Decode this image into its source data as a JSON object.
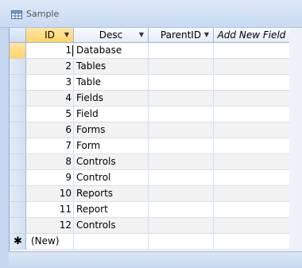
{
  "window": {
    "title": "Sample"
  },
  "columns": [
    {
      "label": "ID",
      "sort_indicator": "▼"
    },
    {
      "label": "Desc",
      "sort_indicator": "▼"
    },
    {
      "label": "ParentID",
      "sort_indicator": "▼"
    },
    {
      "label": "Add New Field"
    }
  ],
  "rows": [
    {
      "id": "1",
      "desc": "Database",
      "parent": ""
    },
    {
      "id": "2",
      "desc": "Tables",
      "parent": ""
    },
    {
      "id": "3",
      "desc": "Table",
      "parent": ""
    },
    {
      "id": "4",
      "desc": "Fields",
      "parent": ""
    },
    {
      "id": "5",
      "desc": "Field",
      "parent": ""
    },
    {
      "id": "6",
      "desc": "Forms",
      "parent": ""
    },
    {
      "id": "7",
      "desc": "Form",
      "parent": ""
    },
    {
      "id": "8",
      "desc": "Controls",
      "parent": ""
    },
    {
      "id": "9",
      "desc": "Control",
      "parent": ""
    },
    {
      "id": "10",
      "desc": "Reports",
      "parent": ""
    },
    {
      "id": "11",
      "desc": "Report",
      "parent": ""
    },
    {
      "id": "12",
      "desc": "Controls",
      "parent": ""
    }
  ],
  "new_row": {
    "marker": "✱",
    "id_placeholder": "(New)"
  },
  "icons": {
    "table": "table-icon",
    "new_record": "asterisk-icon"
  },
  "colors": {
    "selected_header": "#ffd469",
    "grid_border": "#9eb6d4"
  }
}
